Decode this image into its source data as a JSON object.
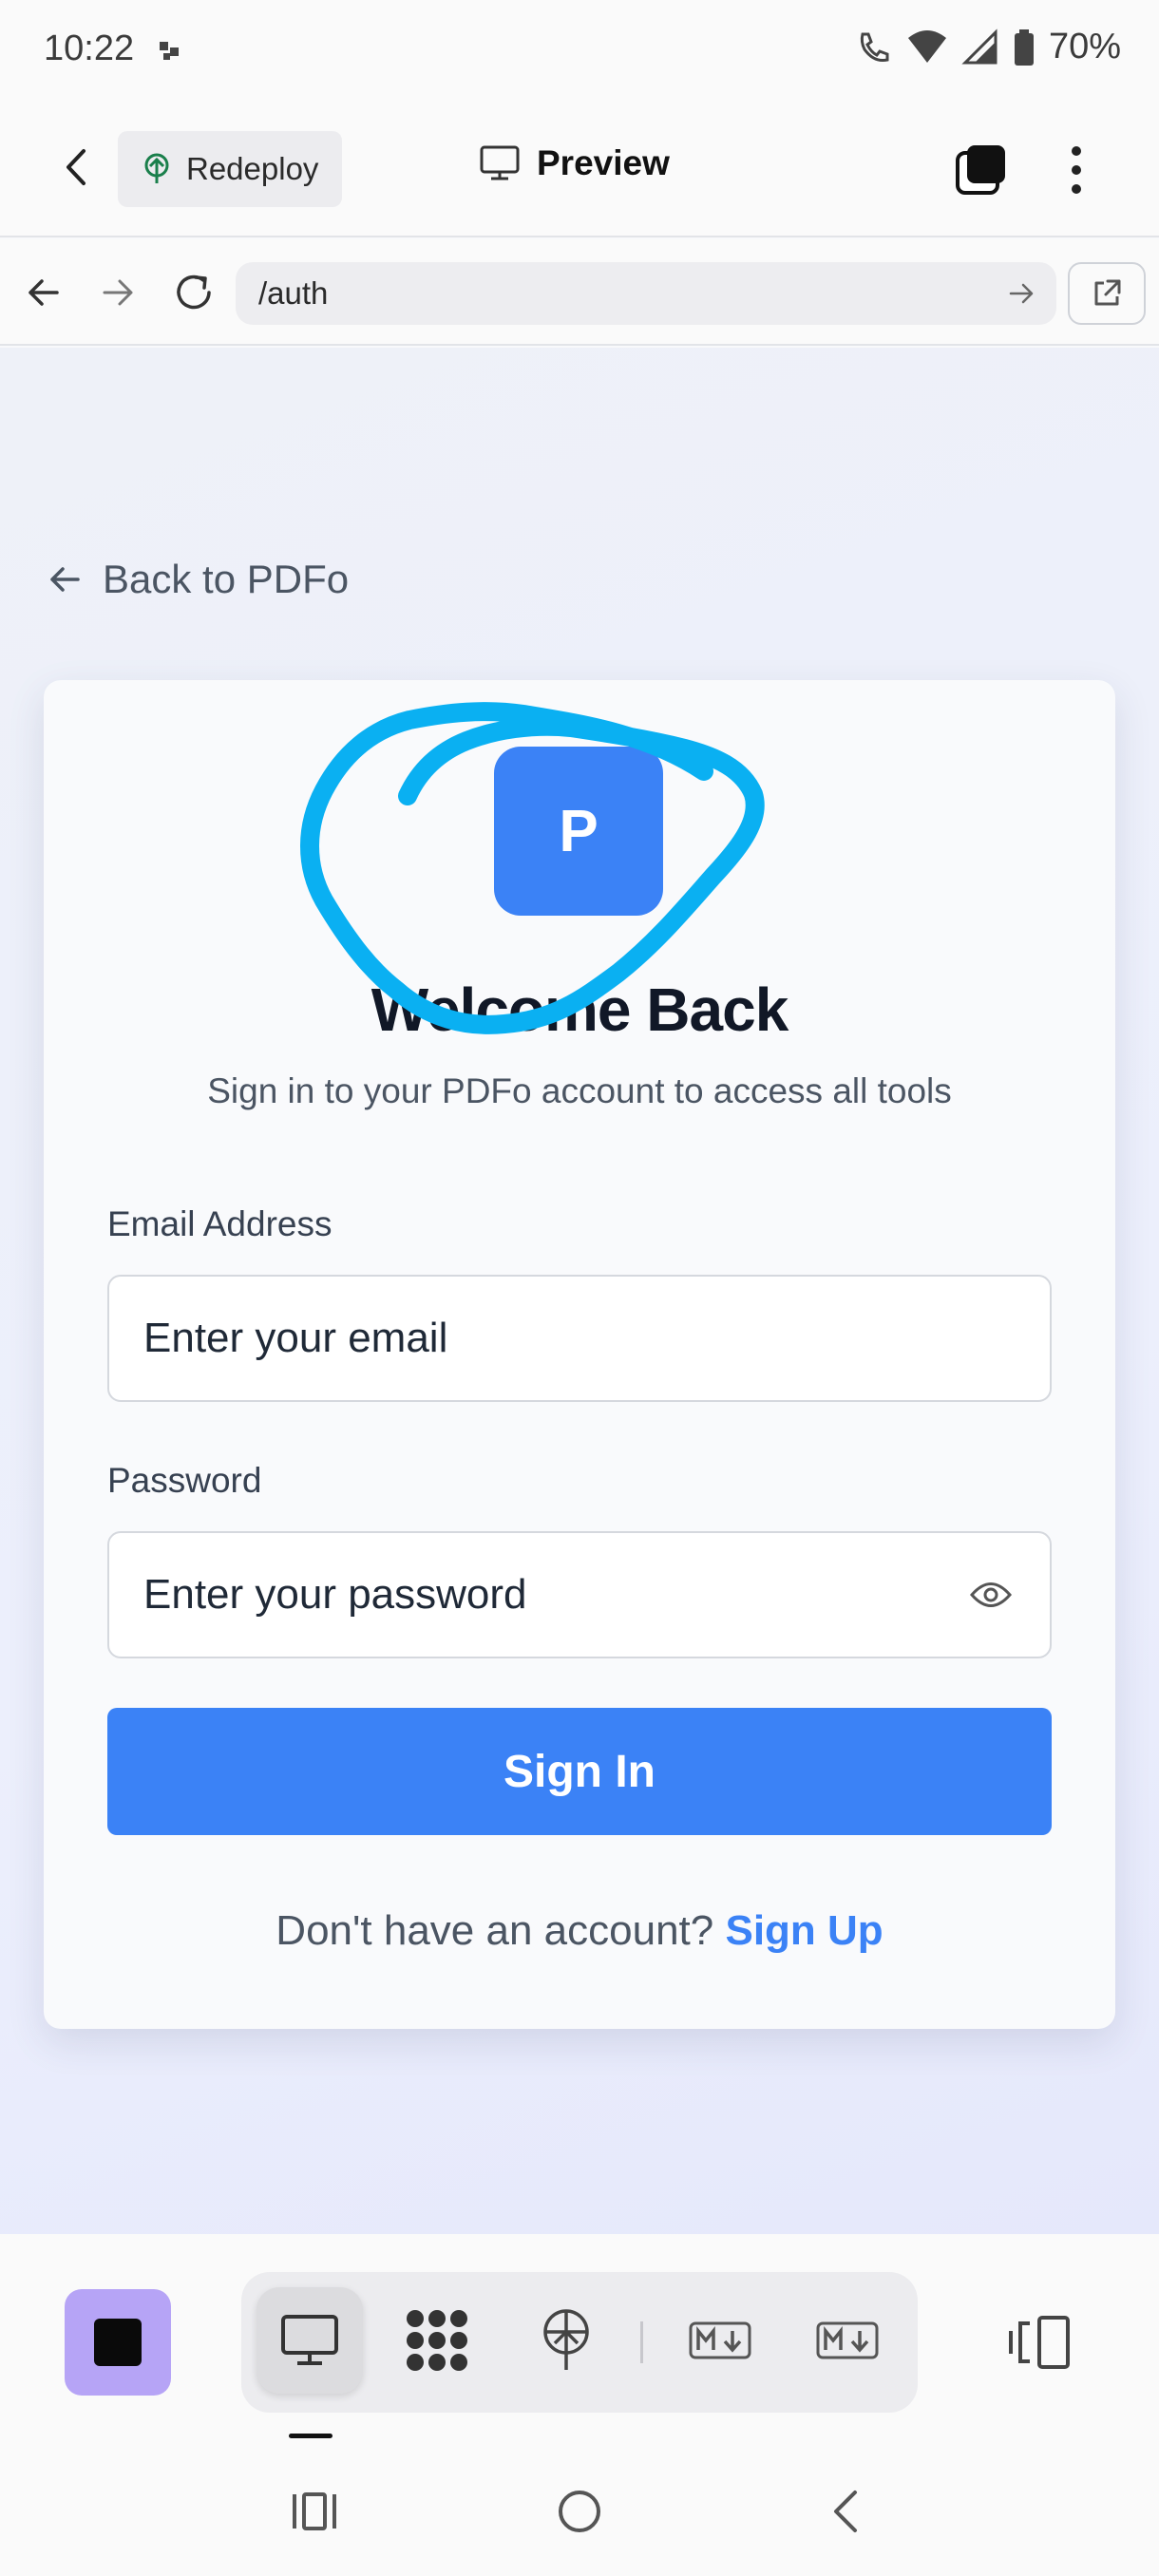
{
  "status_bar": {
    "time": "10:22",
    "battery_percent": "70%"
  },
  "header": {
    "redeploy_label": "Redeploy",
    "preview_label": "Preview"
  },
  "url_bar": {
    "url": "/auth"
  },
  "page": {
    "back_link": "Back to PDFo",
    "logo_letter": "P",
    "title": "Welcome Back",
    "subtitle": "Sign in to your PDFo account to access all tools",
    "email_label": "Email Address",
    "email_placeholder": "Enter your email",
    "password_label": "Password",
    "password_placeholder": "Enter your password",
    "signin_label": "Sign In",
    "signup_prompt": "Don't have an account?",
    "signup_link": "Sign Up"
  },
  "colors": {
    "primary": "#3b82f6",
    "scribble": "#0ab0f2",
    "app_square": "#b6a4f6"
  },
  "toolbar": {
    "icons": [
      "monitor-icon",
      "dots-grid-icon",
      "deploy-icon",
      "markdown-icon",
      "markdown-icon"
    ]
  }
}
